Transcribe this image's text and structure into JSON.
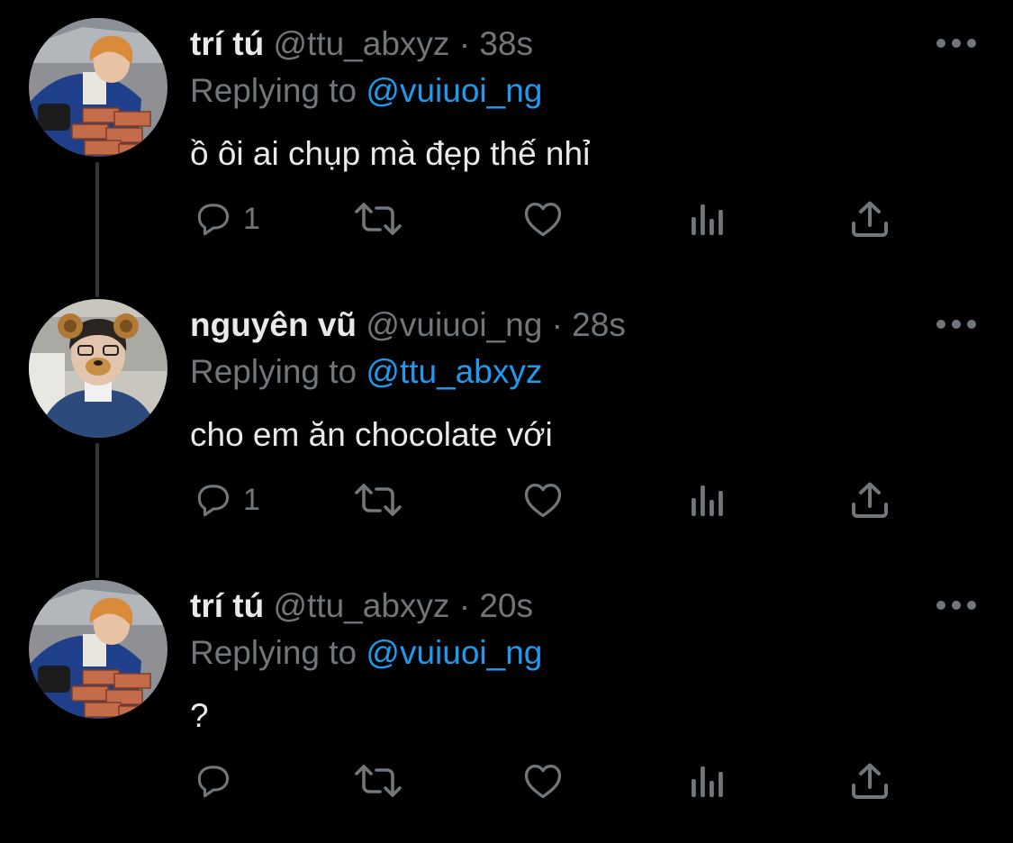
{
  "colors": {
    "background": "#000000",
    "primary_text": "#e7e9ea",
    "secondary_text": "#71767b",
    "link": "#1d9bf0",
    "thread_line": "#333639"
  },
  "tweets": [
    {
      "display_name": "trí tú",
      "handle": "@ttu_abxyz",
      "separator": "·",
      "time": "38s",
      "replying_prefix": "Replying to",
      "replying_to": "@vuiuoi_ng",
      "text": "ồ ôi ai chụp mà đẹp thế nhỉ",
      "reply_count": "1",
      "avatar": "avatar-orange-hair-blue-jacket"
    },
    {
      "display_name": "nguyên vũ",
      "handle": "@vuiuoi_ng",
      "separator": "·",
      "time": "28s",
      "replying_prefix": "Replying to",
      "replying_to": "@ttu_abxyz",
      "text": "cho em ăn chocolate với",
      "reply_count": "1",
      "avatar": "avatar-bear-filter"
    },
    {
      "display_name": "trí tú",
      "handle": "@ttu_abxyz",
      "separator": "·",
      "time": "20s",
      "replying_prefix": "Replying to",
      "replying_to": "@vuiuoi_ng",
      "text": "?",
      "reply_count": "",
      "avatar": "avatar-orange-hair-blue-jacket"
    }
  ],
  "icons": {
    "reply": "reply-icon",
    "retweet": "retweet-icon",
    "like": "heart-icon",
    "views": "views-icon",
    "share": "share-icon",
    "more": "more-icon"
  }
}
